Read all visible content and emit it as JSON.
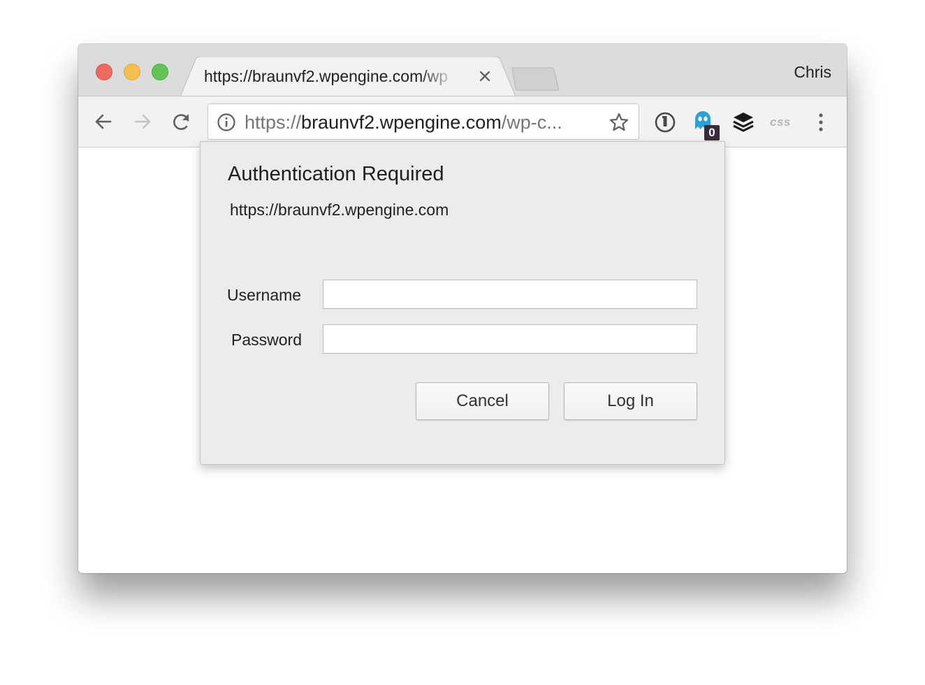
{
  "colors": {
    "traffic_close": "#ed6a5e",
    "traffic_minimize": "#f5bf4f",
    "traffic_zoom": "#61c454",
    "ghostery_blue": "#2d9fd9",
    "badge_bg": "#3a2a3c"
  },
  "browser": {
    "tab": {
      "title": "https://braunvf2.wpengine.com/wp",
      "close_icon": "close-icon"
    },
    "profile_name": "Chris",
    "toolbar": {
      "icons": [
        "back-arrow-icon",
        "forward-arrow-icon",
        "reload-icon"
      ],
      "omnibox": {
        "info_icon": "info-icon",
        "url_scheme": "https://",
        "url_host": "braunvf2.wpengine.com",
        "url_rest": "/wp-c...",
        "star_icon": "star-icon"
      },
      "extensions": {
        "onepassword_icon": "1password-icon",
        "ghostery_icon": "ghostery-icon",
        "ghostery_badge": "0",
        "buffer_icon": "buffer-stack-icon",
        "css_label": "css"
      },
      "menu_icon": "more-vertical-icon"
    }
  },
  "dialog": {
    "title": "Authentication Required",
    "origin": "https://braunvf2.wpengine.com",
    "username_label": "Username",
    "username_value": "",
    "password_label": "Password",
    "password_value": "",
    "cancel_label": "Cancel",
    "login_label": "Log In"
  }
}
